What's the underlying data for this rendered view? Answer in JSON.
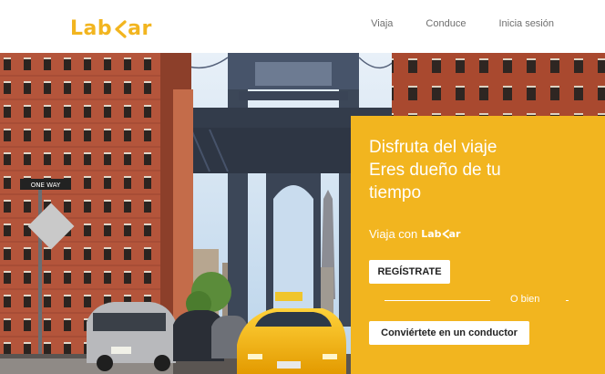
{
  "header": {
    "logo_text_left": "Lab",
    "logo_text_right": "ar",
    "nav": [
      {
        "label": "Viaja"
      },
      {
        "label": "Conduce"
      },
      {
        "label": "Inicia sesión"
      }
    ]
  },
  "hero": {
    "headline_lines": [
      "Disfruta del viaje",
      "Eres dueño de tu",
      "tiempo"
    ],
    "viaja_prefix": "Viaja con",
    "brand_left": "Lab",
    "brand_right": "ar",
    "register_label": "REGÍSTRATE",
    "or_text": "O bien",
    "driver_label": "Conviértete en un conductor",
    "street_sign_text": "ONE WAY"
  },
  "colors": {
    "accent": "#f2b51f",
    "brick": "#b5553a",
    "bridge": "#3f4a5c",
    "taxi": "#f4b400"
  }
}
